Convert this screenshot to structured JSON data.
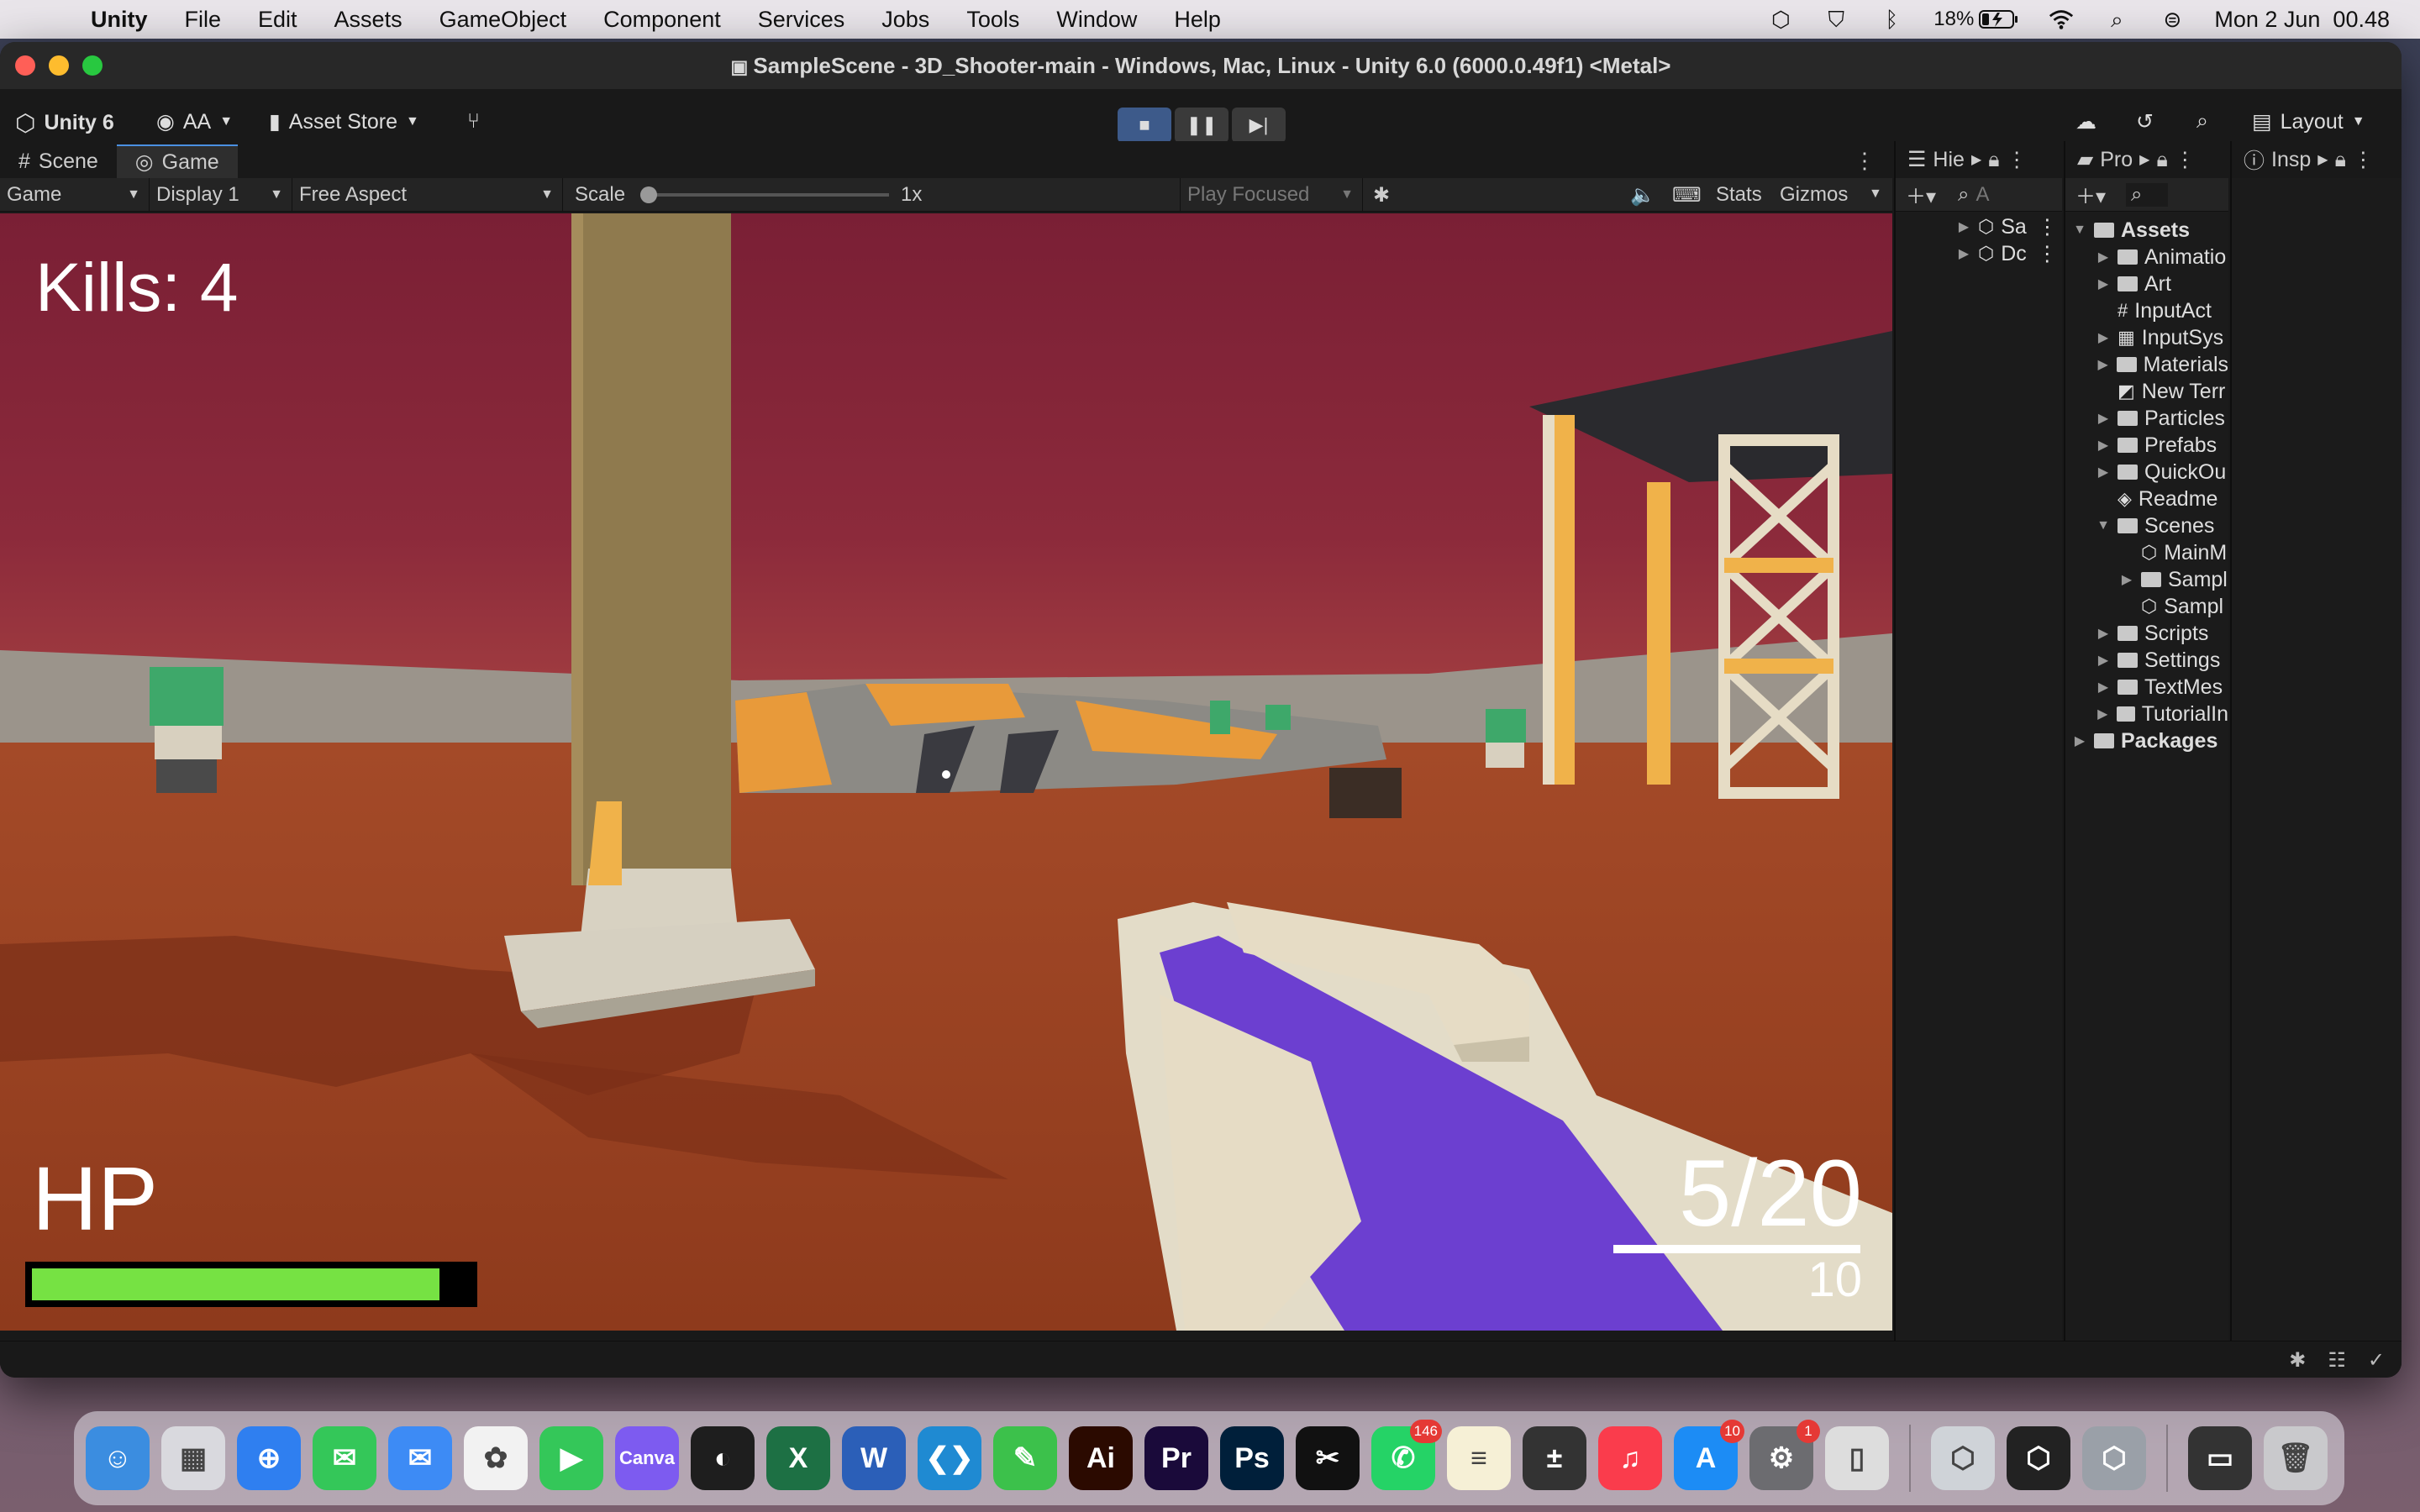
{
  "menubar": {
    "app": "Unity",
    "items": [
      "File",
      "Edit",
      "Assets",
      "GameObject",
      "Component",
      "Services",
      "Jobs",
      "Tools",
      "Window",
      "Help"
    ],
    "battery": "18%",
    "datetime": "Mon 2 Jun  00.48"
  },
  "window": {
    "title": "SampleScene - 3D_Shooter-main - Windows, Mac, Linux - Unity 6.0 (6000.0.49f1) <Metal>"
  },
  "toolbar": {
    "unity_label": "Unity 6",
    "account": "AA",
    "asset_store": "Asset Store",
    "layout": "Layout"
  },
  "game_tabs": [
    "Scene",
    "Game"
  ],
  "game_toolbar": {
    "mode": "Game",
    "display": "Display 1",
    "aspect": "Free Aspect",
    "scale_label": "Scale",
    "scale_value": "1x",
    "play_focus": "Play Focused",
    "stats": "Stats",
    "gizmos": "Gizmos"
  },
  "hud": {
    "kills": "Kills: 4",
    "hp_label": "HP",
    "hp_fraction": 0.93,
    "ammo": "5/20",
    "reserve": "10"
  },
  "hierarchy": {
    "tab": "Hie",
    "search": "A",
    "items": [
      "Sa",
      "Dc"
    ]
  },
  "project": {
    "tab": "Pro",
    "tree": [
      {
        "label": "Assets",
        "depth": 0,
        "type": "folder-open",
        "arrow": "down",
        "bold": true
      },
      {
        "label": "Animatio",
        "depth": 1,
        "type": "folder",
        "arrow": "right"
      },
      {
        "label": "Art",
        "depth": 1,
        "type": "folder",
        "arrow": "right"
      },
      {
        "label": "InputAct",
        "depth": 1,
        "type": "hash",
        "arrow": ""
      },
      {
        "label": "InputSys",
        "depth": 1,
        "type": "map",
        "arrow": "right"
      },
      {
        "label": "Materials",
        "depth": 1,
        "type": "folder",
        "arrow": "right"
      },
      {
        "label": "New Terr",
        "depth": 1,
        "type": "terrain",
        "arrow": ""
      },
      {
        "label": "Particles",
        "depth": 1,
        "type": "folder",
        "arrow": "right"
      },
      {
        "label": "Prefabs",
        "depth": 1,
        "type": "folder",
        "arrow": "right"
      },
      {
        "label": "QuickOu",
        "depth": 1,
        "type": "folder",
        "arrow": "right"
      },
      {
        "label": "Readme",
        "depth": 1,
        "type": "cube",
        "arrow": ""
      },
      {
        "label": "Scenes",
        "depth": 1,
        "type": "folder-open",
        "arrow": "down"
      },
      {
        "label": "MainM",
        "depth": 2,
        "type": "unity",
        "arrow": ""
      },
      {
        "label": "Sampl",
        "depth": 2,
        "type": "folder",
        "arrow": "right"
      },
      {
        "label": "Sampl",
        "depth": 2,
        "type": "unity",
        "arrow": ""
      },
      {
        "label": "Scripts",
        "depth": 1,
        "type": "folder",
        "arrow": "right"
      },
      {
        "label": "Settings",
        "depth": 1,
        "type": "folder",
        "arrow": "right"
      },
      {
        "label": "TextMes",
        "depth": 1,
        "type": "folder",
        "arrow": "right"
      },
      {
        "label": "TutorialIn",
        "depth": 1,
        "type": "folder",
        "arrow": "right"
      },
      {
        "label": "Packages",
        "depth": 0,
        "type": "folder",
        "arrow": "right",
        "bold": true
      }
    ]
  },
  "inspector": {
    "tab": "Insp"
  },
  "dock": [
    {
      "name": "finder-icon",
      "color": "#3b8de0",
      "glyph": "☺"
    },
    {
      "name": "launchpad-icon",
      "color": "#d9d9de",
      "glyph": "▦"
    },
    {
      "name": "safari-icon",
      "color": "#2f7ff0",
      "glyph": "⊕"
    },
    {
      "name": "messages-icon",
      "color": "#34c759",
      "glyph": "✉"
    },
    {
      "name": "mail-icon",
      "color": "#3d8bf5",
      "glyph": "✉"
    },
    {
      "name": "photos-icon",
      "color": "#f2f2f2",
      "glyph": "✿"
    },
    {
      "name": "facetime-icon",
      "color": "#34c759",
      "glyph": "▶"
    },
    {
      "name": "canva-icon",
      "color": "#7d5bf0",
      "glyph": "Canva"
    },
    {
      "name": "figma-icon",
      "color": "#1e1e1e",
      "glyph": "◐"
    },
    {
      "name": "excel-icon",
      "color": "#1d7044",
      "glyph": "X"
    },
    {
      "name": "word-icon",
      "color": "#2b5fb8",
      "glyph": "W"
    },
    {
      "name": "vscode-icon",
      "color": "#1f8ad2",
      "glyph": "❮❯"
    },
    {
      "name": "pen-app-icon",
      "color": "#3cc14b",
      "glyph": "✎"
    },
    {
      "name": "illustrator-icon",
      "color": "#2b0a00",
      "glyph": "Ai"
    },
    {
      "name": "premiere-icon",
      "color": "#1a0a3a",
      "glyph": "Pr"
    },
    {
      "name": "photoshop-icon",
      "color": "#001f3a",
      "glyph": "Ps"
    },
    {
      "name": "capcut-icon",
      "color": "#111",
      "glyph": "✂"
    },
    {
      "name": "whatsapp-icon",
      "color": "#25d366",
      "glyph": "✆",
      "badge": "146"
    },
    {
      "name": "notes-icon",
      "color": "#f6f0d6",
      "glyph": "≡"
    },
    {
      "name": "calculator-icon",
      "color": "#333",
      "glyph": "±"
    },
    {
      "name": "music-icon",
      "color": "#fa3c4c",
      "glyph": "♫"
    },
    {
      "name": "app-store-icon",
      "color": "#1c8cf5",
      "glyph": "A",
      "badge": "10"
    },
    {
      "name": "system-settings-icon",
      "color": "#6c6c70",
      "glyph": "⚙",
      "badge": "1"
    },
    {
      "name": "iphone-mirroring-icon",
      "color": "#ddd",
      "glyph": "▯"
    },
    {
      "name": "unity-hub-icon",
      "color": "#cfd3d8",
      "glyph": "⬡",
      "sep": true
    },
    {
      "name": "unity-icon",
      "color": "#222",
      "glyph": "⬡"
    },
    {
      "name": "unity-6-icon",
      "color": "#9aa0a8",
      "glyph": "⬡"
    },
    {
      "name": "recent-window-icon",
      "color": "#333",
      "glyph": "▭",
      "sep": true
    },
    {
      "name": "trash-icon",
      "color": "#c9c9cc",
      "glyph": "🗑"
    }
  ]
}
